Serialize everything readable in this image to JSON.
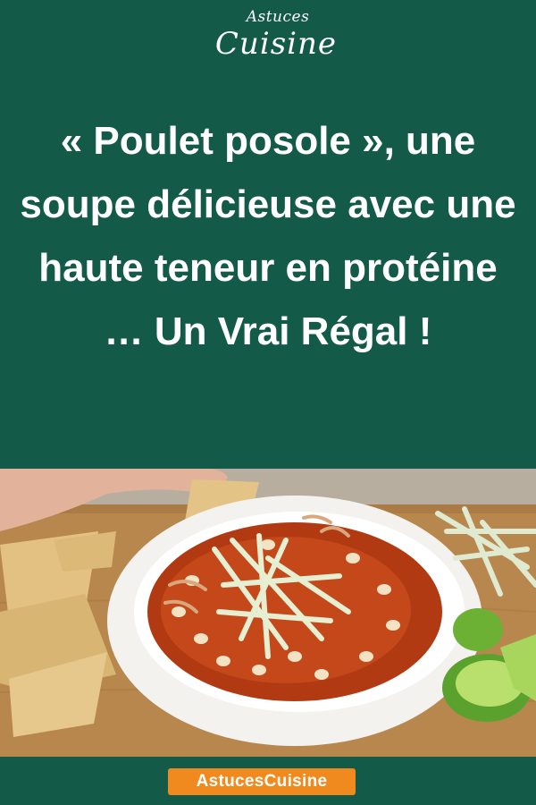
{
  "brand": {
    "logo_line1": "Astuces",
    "logo_line2": "Cuisine",
    "footer_label": "AstucesCuisine"
  },
  "article": {
    "title": "« Poulet posole », une soupe délicieuse avec une haute teneur en protéine … Un Vrai Régal !"
  },
  "photo": {
    "icon": "pozole-soup-photo"
  },
  "colors": {
    "background": "#145a48",
    "title_text": "#ffffff",
    "badge": "#f08a1e"
  }
}
